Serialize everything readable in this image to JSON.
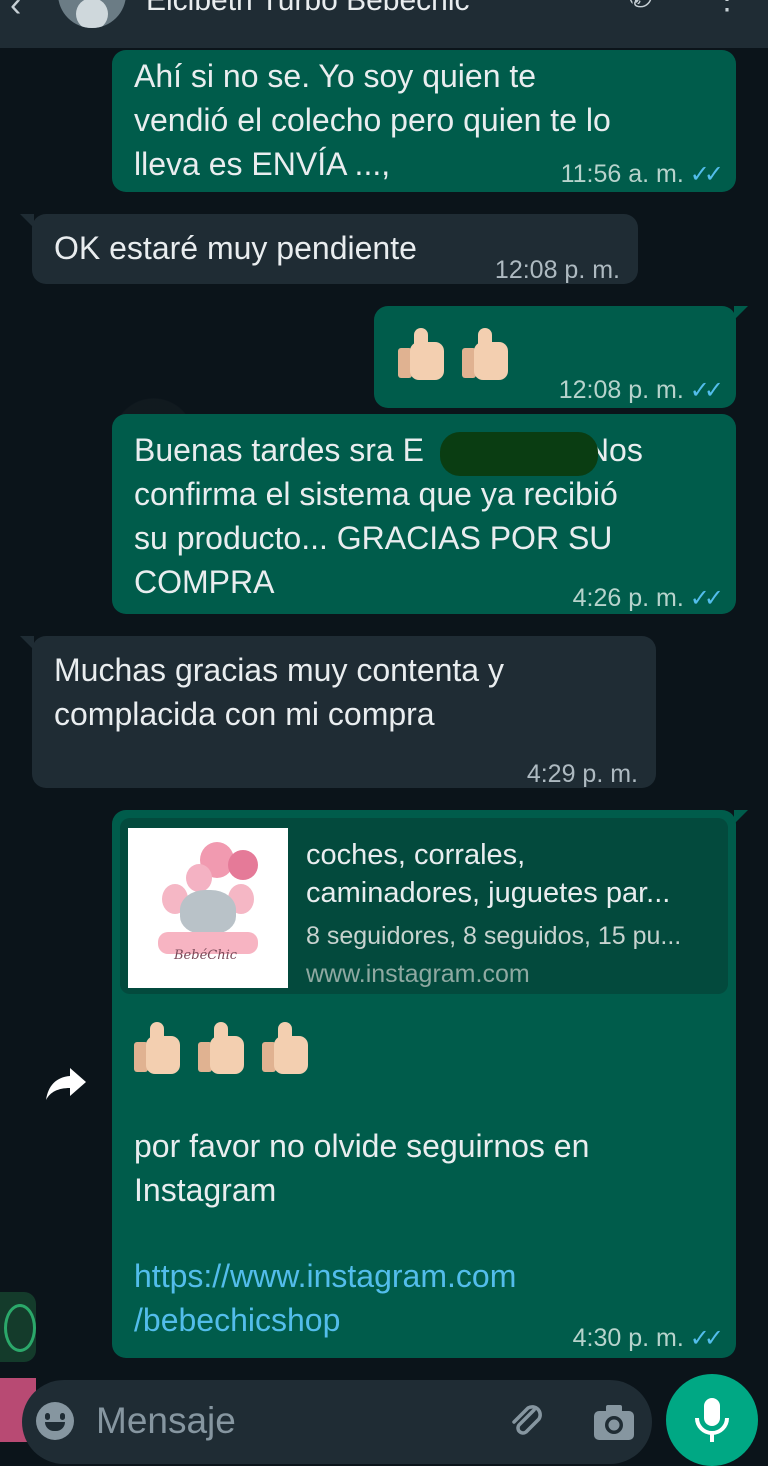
{
  "header": {
    "back_icon": "arrow-left-icon",
    "contact_name": "Elcibeth Turbo Bebechic",
    "call_icon": "phone-add-icon",
    "menu_icon": "more-vertical-icon"
  },
  "messages": [
    {
      "direction": "out",
      "text": "Ahí si no se.   Yo soy quien te\nvendió el colecho  pero quien te lo\nlleva es  ENVÍA ...,",
      "time": "11:56 a. m.",
      "status": "read"
    },
    {
      "direction": "in",
      "text": "OK estaré muy pendiente",
      "time": "12:08 p. m."
    },
    {
      "direction": "out",
      "emoji": "thumbs-up x2",
      "time": "12:08 p. m.",
      "status": "read"
    },
    {
      "direction": "out",
      "text_before": "Buenas tardes sra E",
      "text_after": "Nos\nconfirma el sistema que ya recibió\nsu producto... GRACIAS POR SU\nCOMPRA",
      "time": "4:26 p. m.",
      "status": "read"
    },
    {
      "direction": "in",
      "text": "Muchas gracias muy contenta y\ncomplacida con mi compra",
      "time": "4:29 p. m."
    },
    {
      "direction": "out",
      "link_preview": {
        "title": "coches, corrales,\ncaminadores, juguetes par...",
        "description": "8 seguidores, 8 seguidos, 15 pu...",
        "domain": "www.instagram.com",
        "logo_text": "BebéChic"
      },
      "emoji": "thumbs-up x3",
      "text": "por favor no olvide seguirnos en\nInstagram",
      "link": "https://www.instagram.com\n/bebechicshop",
      "time": "4:30 p. m.",
      "status": "read"
    }
  ],
  "read_ticks": "✓✓",
  "input": {
    "placeholder": "Mensaje",
    "emoji_icon": "smiley-icon",
    "attach_icon": "paperclip-icon",
    "camera_icon": "camera-icon",
    "mic_icon": "microphone-icon"
  },
  "colors": {
    "background": "#0b141a",
    "outgoing_bubble": "#005c4b",
    "incoming_bubble": "#1f2c34",
    "read_ticks": "#53bdeb",
    "accent": "#00a884"
  }
}
